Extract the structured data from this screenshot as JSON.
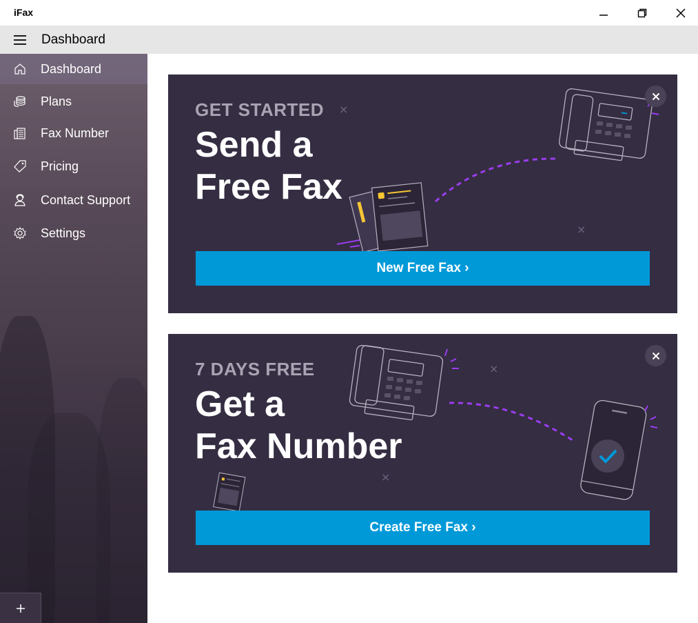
{
  "window": {
    "title": "iFax"
  },
  "navbar": {
    "title": "Dashboard"
  },
  "sidebar": {
    "items": [
      {
        "label": "Dashboard",
        "icon": "home-icon"
      },
      {
        "label": "Plans",
        "icon": "coins-icon"
      },
      {
        "label": "Fax Number",
        "icon": "fax-number-icon"
      },
      {
        "label": "Pricing",
        "icon": "tag-icon"
      },
      {
        "label": "Contact Support",
        "icon": "support-agent-icon"
      },
      {
        "label": "Settings",
        "icon": "gear-icon"
      }
    ],
    "add_icon": "plus-icon"
  },
  "cards": [
    {
      "eyebrow": "GET STARTED",
      "headline_1": "Send a",
      "headline_2": "Free Fax",
      "cta": "New Free Fax ›"
    },
    {
      "eyebrow": "7 DAYS FREE",
      "headline_1": "Get a",
      "headline_2": "Fax Number",
      "cta": "Create Free Fax ›"
    }
  ],
  "colors": {
    "accent": "#0099d8",
    "card_bg": "#352d42",
    "purple": "#9b3df0",
    "yellow": "#f5c533"
  }
}
